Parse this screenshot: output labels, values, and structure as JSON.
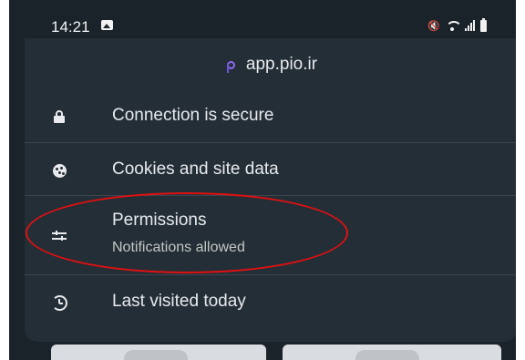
{
  "status_bar": {
    "time": "14:21",
    "icons": [
      "gallery-icon",
      "mute-icon",
      "wifi-icon",
      "signal-icon",
      "battery-icon"
    ]
  },
  "site_info": {
    "domain": "app.pio.ir",
    "logo": "pio-logo",
    "items": [
      {
        "icon": "lock-icon",
        "label": "Connection is secure"
      },
      {
        "icon": "cookie-icon",
        "label": "Cookies and site data"
      },
      {
        "icon": "sliders-icon",
        "label": "Permissions",
        "sublabel": "Notifications allowed"
      },
      {
        "icon": "history-icon",
        "label": "Last visited today"
      }
    ]
  },
  "annotation": {
    "shape": "ellipse",
    "color": "#e01010",
    "target": "Permissions"
  },
  "colors": {
    "sheet_background": "#232e37",
    "status_bar": "#1a2329",
    "text_primary": "#e8eaed",
    "text_secondary": "#c4c7c5",
    "logo_accent": "#8e6af1"
  }
}
